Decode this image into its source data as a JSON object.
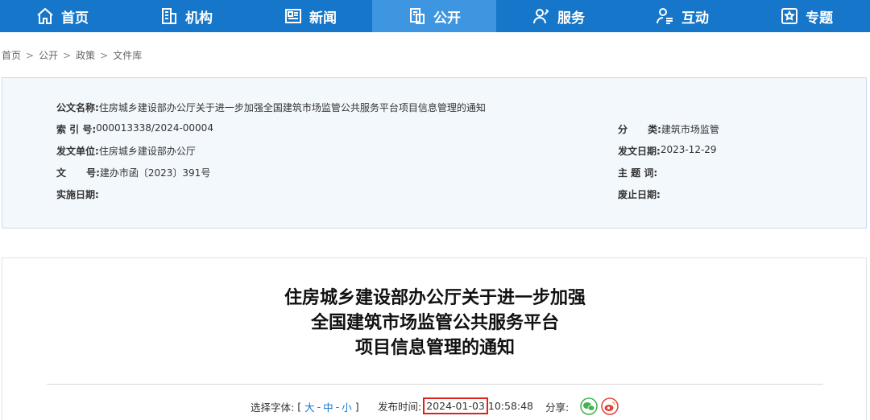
{
  "nav": {
    "items": [
      {
        "label": "首页",
        "icon": "home-icon"
      },
      {
        "label": "机构",
        "icon": "building-icon"
      },
      {
        "label": "新闻",
        "icon": "news-icon"
      },
      {
        "label": "公开",
        "icon": "document-icon"
      },
      {
        "label": "服务",
        "icon": "user-service-icon"
      },
      {
        "label": "互动",
        "icon": "interact-icon"
      },
      {
        "label": "专题",
        "icon": "star-icon"
      }
    ],
    "active": "公开",
    "colors": {
      "bar": "#1676c9",
      "active": "#3e95e0"
    }
  },
  "breadcrumb": {
    "items": [
      "首页",
      "公开",
      "政策",
      "文件库"
    ],
    "separator": ">"
  },
  "info": {
    "doc_name_label": "公文名称:",
    "doc_name": "住房城乡建设部办公厅关于进一步加强全国建筑市场监管公共服务平台项目信息管理的通知",
    "index_label": "索 引 号:",
    "index": "000013338/2024-00004",
    "category_label": "分      类:",
    "category": "建筑市场监管",
    "issuer_label": "发文单位:",
    "issuer": "住房城乡建设部办公厅",
    "issue_date_label": "发文日期:",
    "issue_date": "2023-12-29",
    "doc_no_label": "文      号:",
    "doc_no": "建办市函〔2023〕391号",
    "subject_label": "主 题 词:",
    "subject": "",
    "effective_label": "实施日期:",
    "effective": "",
    "expire_label": "废止日期:",
    "expire": ""
  },
  "article": {
    "title_lines": [
      "住房城乡建设部办公厅关于进一步加强",
      "全国建筑市场监管公共服务平台",
      "项目信息管理的通知"
    ],
    "font_select_label": "选择字体:",
    "font_open": "[",
    "font_large": "大",
    "font_sep1": "-",
    "font_medium": "中",
    "font_sep2": "-",
    "font_small": "小",
    "font_close": "]",
    "publish_label": "发布时间:",
    "publish_date": "2024-01-03",
    "publish_time": "10:58:48",
    "share_label": "分享:",
    "highlight_color": "#e02020",
    "share_icons": [
      "wechat-icon",
      "weibo-icon"
    ]
  }
}
